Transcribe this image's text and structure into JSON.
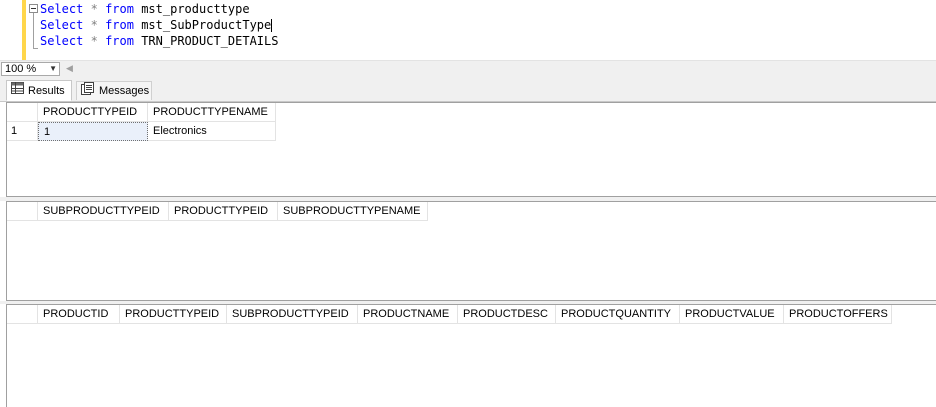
{
  "editor": {
    "lines": [
      {
        "kw1": "Select",
        "op": "*",
        "kw2": "from",
        "table": "mst_producttype"
      },
      {
        "kw1": "Select",
        "op": "*",
        "kw2": "from",
        "table": "mst_SubProductType"
      },
      {
        "kw1": "Select",
        "op": "*",
        "kw2": "from",
        "table": "TRN_PRODUCT_DETAILS"
      }
    ]
  },
  "zoom": {
    "value": "100 %"
  },
  "tabs": {
    "results": "Results",
    "messages": "Messages"
  },
  "grid1": {
    "columns": [
      "PRODUCTTYPEID",
      "PRODUCTTYPENAME"
    ],
    "rows": [
      {
        "num": "1",
        "cells": [
          "1",
          "Electronics"
        ]
      }
    ]
  },
  "grid2": {
    "columns": [
      "SUBPRODUCTTYPEID",
      "PRODUCTTYPEID",
      "SUBPRODUCTTYPENAME"
    ]
  },
  "grid3": {
    "columns": [
      "PRODUCTID",
      "PRODUCTTYPEID",
      "SUBPRODUCTTYPEID",
      "PRODUCTNAME",
      "PRODUCTDESC",
      "PRODUCTQUANTITY",
      "PRODUCTVALUE",
      "PRODUCTOFFERS"
    ]
  },
  "colors": {
    "keyword": "#0000ff",
    "margin": "#ffd64a"
  },
  "icons": {
    "fold": "collapse-icon",
    "results": "grid-icon",
    "messages": "messages-icon",
    "zoom": "chevron-down-icon"
  }
}
